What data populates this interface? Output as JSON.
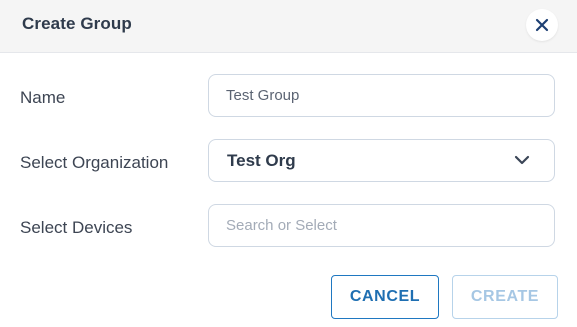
{
  "dialog": {
    "title": "Create Group",
    "close_icon": "close-icon"
  },
  "form": {
    "name": {
      "label": "Name",
      "value": "Test Group"
    },
    "organization": {
      "label": "Select Organization",
      "selected": "Test Org",
      "icon": "chevron-down-icon"
    },
    "devices": {
      "label": "Select Devices",
      "placeholder": "Search or Select"
    }
  },
  "actions": {
    "cancel_label": "CANCEL",
    "create_label": "CREATE"
  },
  "colors": {
    "header_bg": "#f5f5f5",
    "primary": "#1f6fb2",
    "primary_disabled": "#a6c7e4",
    "text": "#3d4553"
  }
}
